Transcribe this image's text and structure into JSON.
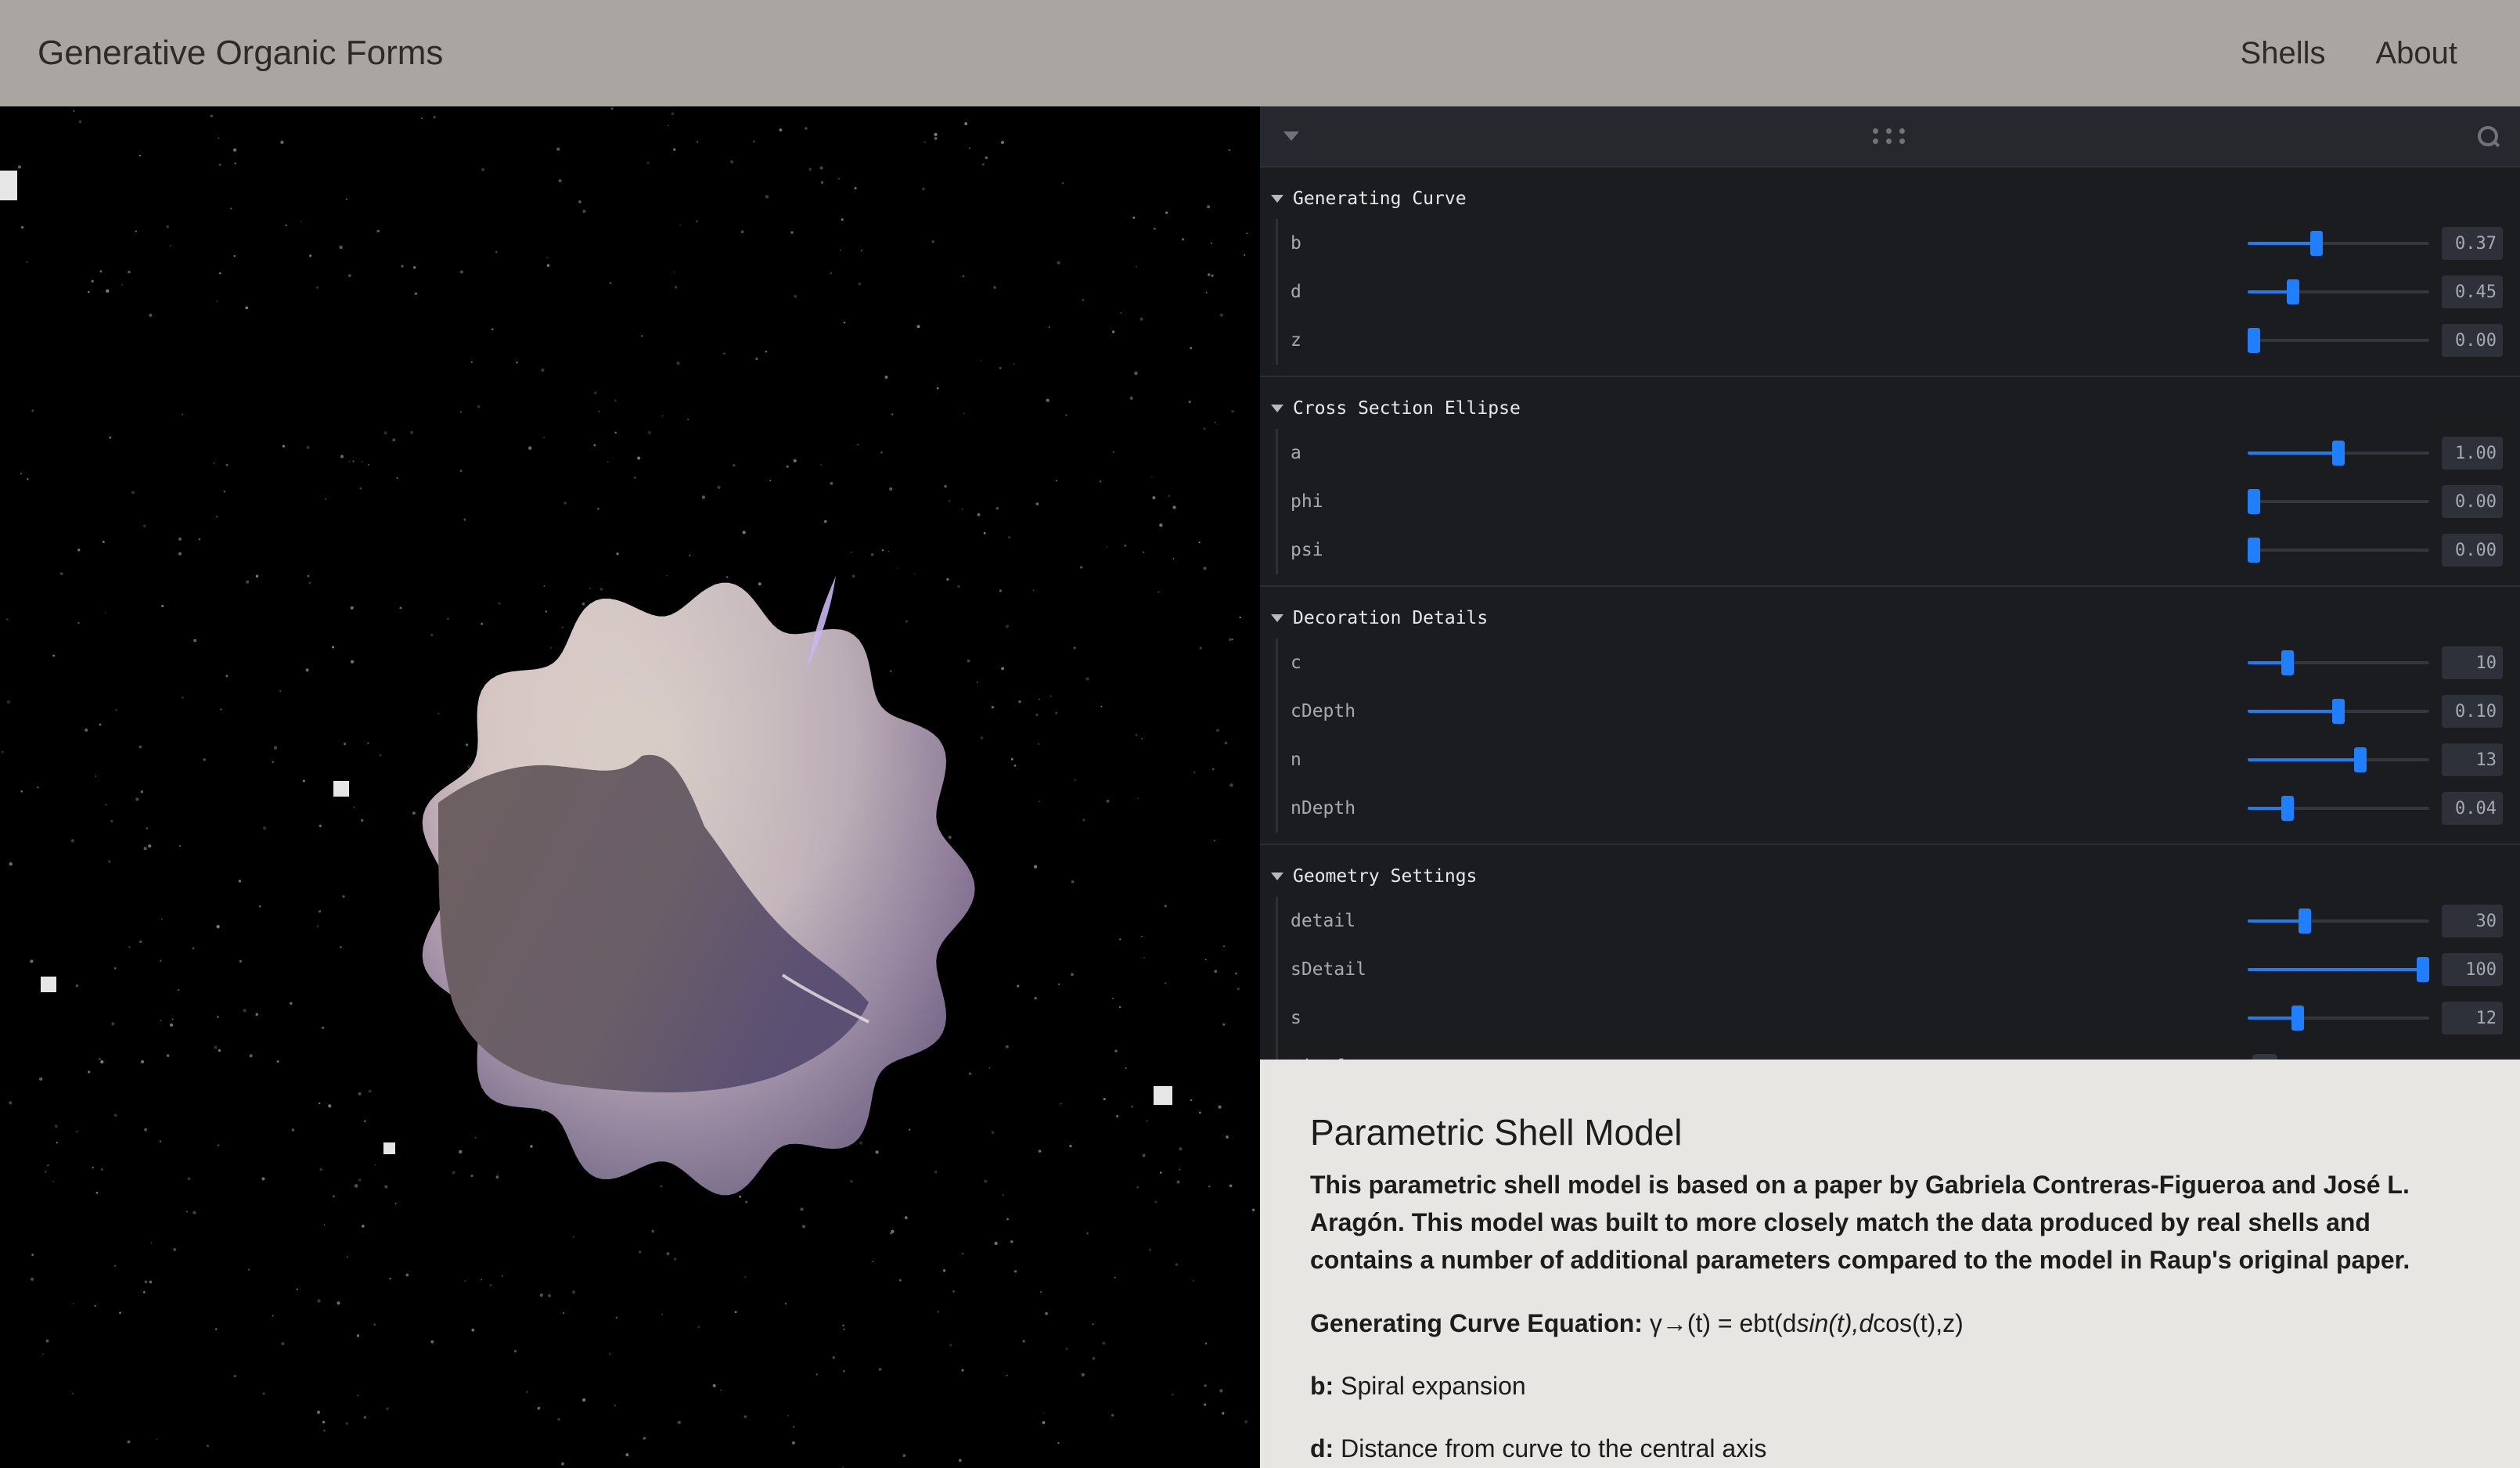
{
  "header": {
    "title": "Generative Organic Forms",
    "nav": [
      {
        "label": "Shells"
      },
      {
        "label": "About"
      }
    ]
  },
  "panel": {
    "folders": [
      {
        "title": "Generating Curve",
        "rows": [
          {
            "label": "b",
            "value": "0.37",
            "fraction": 0.37
          },
          {
            "label": "d",
            "value": "0.45",
            "fraction": 0.23
          },
          {
            "label": "z",
            "value": "0.00",
            "fraction": 0.0
          }
        ]
      },
      {
        "title": "Cross Section Ellipse",
        "rows": [
          {
            "label": "a",
            "value": "1.00",
            "fraction": 0.5
          },
          {
            "label": "phi",
            "value": "0.00",
            "fraction": 0.0
          },
          {
            "label": "psi",
            "value": "0.00",
            "fraction": 0.0
          }
        ]
      },
      {
        "title": "Decoration Details",
        "rows": [
          {
            "label": "c",
            "value": "10",
            "fraction": 0.2
          },
          {
            "label": "cDepth",
            "value": "0.10",
            "fraction": 0.5
          },
          {
            "label": "n",
            "value": "13",
            "fraction": 0.63
          },
          {
            "label": "nDepth",
            "value": "0.04",
            "fraction": 0.2
          }
        ]
      },
      {
        "title": "Geometry Settings",
        "rows": [
          {
            "label": "detail",
            "value": "30",
            "fraction": 0.3
          },
          {
            "label": "sDetail",
            "value": "100",
            "fraction": 1.0
          },
          {
            "label": "s",
            "value": "12",
            "fraction": 0.26
          }
        ],
        "checkbox": {
          "label": "wireframe",
          "checked": false
        }
      }
    ]
  },
  "info": {
    "heading": "Parametric Shell Model",
    "lead": "This parametric shell model is based on a paper by Gabriela Contreras-Figueroa and José L. Aragón. This model was built to more closely match the data produced by real shells and contains a number of additional parameters compared to the model in Raup's original paper.",
    "equation_label": "Generating Curve Equation:",
    "equation_lhs": "γ→(t) = ebt(d",
    "equation_sin": "sin(t),d",
    "equation_rhs": "cos(t),z)",
    "params": [
      {
        "key": "b:",
        "desc": "Spiral expansion"
      },
      {
        "key": "d:",
        "desc": "Distance from curve to the central axis"
      }
    ]
  },
  "colors": {
    "header_bg": "#a9a5a1",
    "accent": "#1f7fff",
    "panel_bg": "#1b1c20",
    "info_bg": "#e7e6e3"
  }
}
